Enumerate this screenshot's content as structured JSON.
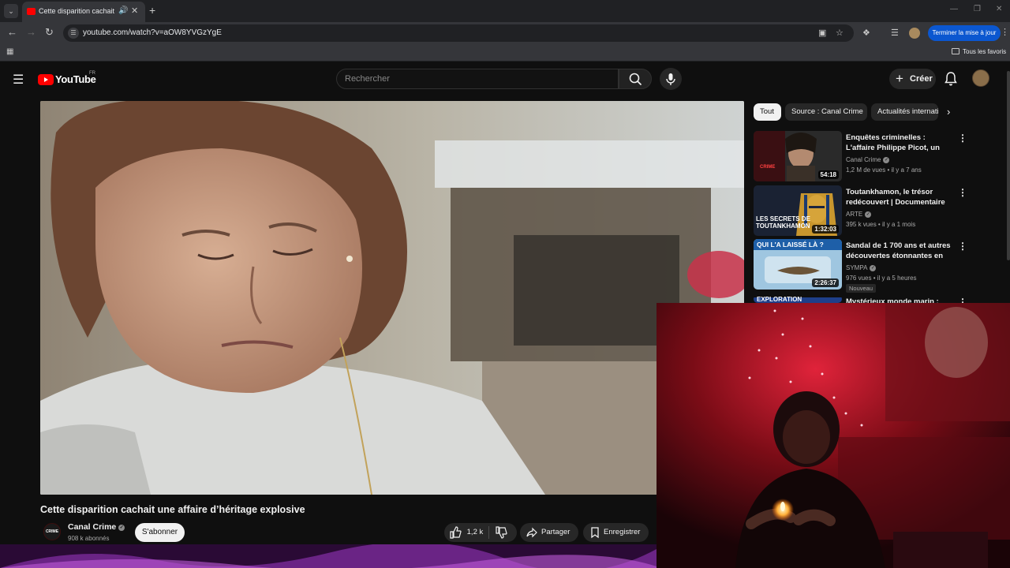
{
  "browser": {
    "tab_title": "Cette disparition cachait une affaire d'héritage explosive - YouTube",
    "url": "youtube.com/watch?v=aOW8YVGzYgE",
    "update_button": "Terminer la mise à jour",
    "bookmarks_folder": "Tous les favoris"
  },
  "youtube": {
    "logo_text": "YouTube",
    "country_code": "FR",
    "search_placeholder": "Rechercher",
    "create_label": "Créer"
  },
  "video": {
    "title": "Cette disparition cachait une affaire d’héritage explosive",
    "channel": "Canal Crime",
    "channel_avatar_text": "CRIME",
    "subscribers": "908 k abonnés",
    "subscribe_label": "S'abonner",
    "likes": "1,2 k",
    "share_label": "Partager",
    "save_label": "Enregistrer"
  },
  "sidebar": {
    "chips": [
      "Tout",
      "Source : Canal Crime",
      "Actualités internationales"
    ],
    "recommendations": [
      {
        "title": "Enquêtes criminelles : L'affaire Philippe Picot, un crime presque parfait",
        "channel": "Canal Crime",
        "views": "1,2 M de vues",
        "age": "il y a 7 ans",
        "duration": "54:18",
        "thumb_text": "CRIME"
      },
      {
        "title": "Toutankhamon, le trésor redécouvert | Documentaire ARTE",
        "channel": "ARTE",
        "views": "395 k vues",
        "age": "il y a 1 mois",
        "duration": "1:32:03",
        "thumb_text": "LES SECRETS DE TOUTANKHAMON"
      },
      {
        "title": "Sandal de 1 700 ans et autres découvertes étonnantes en glace",
        "channel": "SYMPA",
        "views": "976 vues",
        "age": "il y a 5 heures",
        "duration": "2:26:37",
        "thumb_text": "QUI L'A LAISSÉ LÀ ?",
        "badge": "Nouveau"
      },
      {
        "title": "Mystérieux monde marin :",
        "thumb_text": "EXPLORATION"
      }
    ]
  },
  "colors": {
    "yt_red": "#ff0000",
    "background": "#0f0f0f",
    "chrome_blue": "#0b57d0"
  }
}
